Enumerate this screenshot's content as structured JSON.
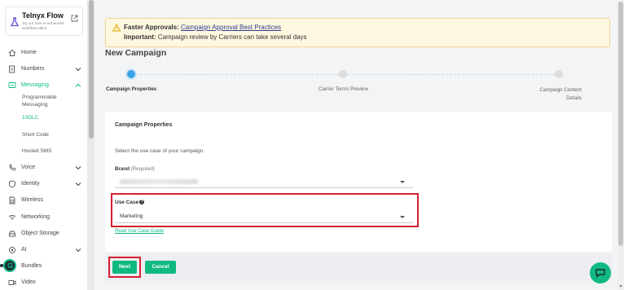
{
  "brand": {
    "title": "Telnyx Flow",
    "subtitle": "Try our new AI-enhanced workflow editor"
  },
  "nav": {
    "items": [
      {
        "label": "Home",
        "icon": "home-icon"
      },
      {
        "label": "Numbers",
        "icon": "phone-book-icon"
      },
      {
        "label": "Messaging",
        "icon": "message-icon"
      },
      {
        "label": "Voice",
        "icon": "voice-icon"
      },
      {
        "label": "Identity",
        "icon": "shield-icon"
      },
      {
        "label": "Wireless",
        "icon": "sim-icon"
      },
      {
        "label": "Networking",
        "icon": "wifi-icon"
      },
      {
        "label": "Object Storage",
        "icon": "storage-icon"
      },
      {
        "label": "AI",
        "icon": "ai-icon"
      },
      {
        "label": "Bundles",
        "icon": "bundle-icon"
      },
      {
        "label": "Video",
        "icon": "video-icon"
      }
    ],
    "messaging_sub": [
      "Programmable Messaging",
      "10DLC",
      "Short Code",
      "Hosted SMS"
    ]
  },
  "alert": {
    "label1": "Faster Approvals:",
    "link": "Campaign Approval Best Practices",
    "label2": "Important:",
    "text2": "Campaign review by Carriers can take several days"
  },
  "page_title": "New Campaign",
  "steps": [
    "Campaign Properties",
    "Carrier Terms Preview",
    "Campaign Content Details"
  ],
  "form": {
    "section_title": "Campaign Properties",
    "description": "Select the use case of your campaign.",
    "brand_label": "Brand",
    "brand_required": "(Required)",
    "use_case_label": "Use Case",
    "use_case_value": "Marketing",
    "guide_link": "Read Use Case Guide"
  },
  "buttons": {
    "next": "Next",
    "cancel": "Cancel"
  },
  "colors": {
    "accent": "#10b981",
    "highlight": "#d32030",
    "step_active": "#3ba3e8",
    "alert_bg": "#fff8e1"
  }
}
